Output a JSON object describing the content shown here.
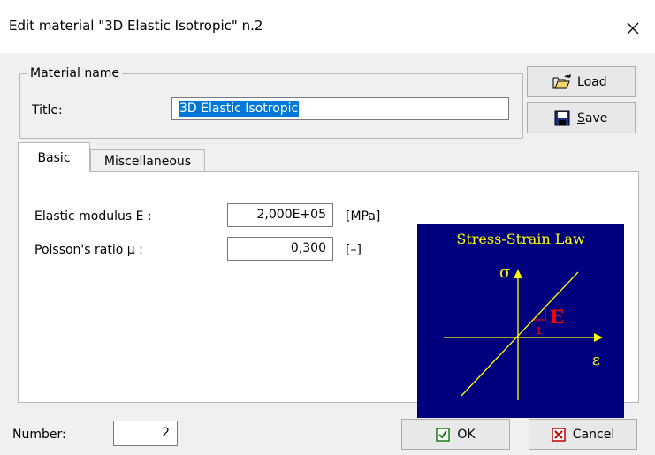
{
  "window": {
    "title": "Edit material  \"3D Elastic Isotropic\" n.2"
  },
  "material_group": {
    "legend": "Material name",
    "title_label": "Title:",
    "title_value": "3D Elastic Isotropic"
  },
  "buttons": {
    "load_first": "L",
    "load_rest": "oad",
    "save_first": "S",
    "save_rest": "ave",
    "ok": "OK",
    "cancel": "Cancel"
  },
  "tabs": [
    {
      "label": "Basic",
      "active": true
    },
    {
      "label": "Miscellaneous",
      "active": false
    }
  ],
  "basic": {
    "elastic_label": "Elastic modulus E :",
    "elastic_value": "2,000E+05",
    "elastic_unit": "[MPa]",
    "poisson_label": "Poisson's ratio μ :",
    "poisson_value": "0,300",
    "poisson_unit": "[–]"
  },
  "diagram": {
    "title": "Stress-Strain Law",
    "y_axis": "σ",
    "x_axis": "ε",
    "slope_label": "E",
    "unit_label": "1",
    "colors": {
      "background": "#00007f",
      "lines": "#ffff00",
      "slope": "#ff0000"
    }
  },
  "footer": {
    "number_label": "Number:",
    "number_value": "2"
  }
}
